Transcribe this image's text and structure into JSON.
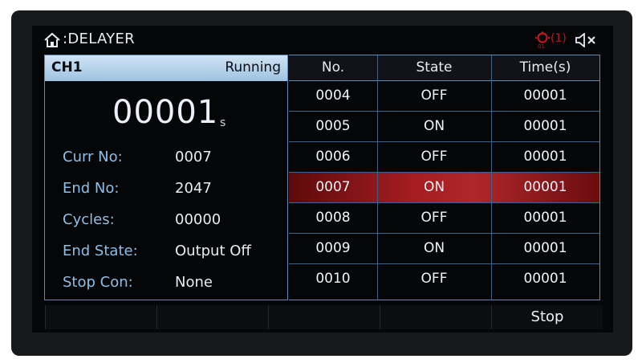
{
  "header": {
    "title": ":DELAYER",
    "icons": [
      "home-icon",
      "overcurrent-warning-icon",
      "speaker-mute-icon"
    ],
    "alert_count": "(1)",
    "alert_color": "#c0181c"
  },
  "channel": {
    "name": "CH1",
    "status": "Running",
    "time_value": "00001",
    "time_unit": "s",
    "fields": [
      {
        "label": "Curr No:",
        "value": "0007"
      },
      {
        "label": "End No:",
        "value": "2047"
      },
      {
        "label": "Cycles:",
        "value": "00000"
      },
      {
        "label": "End State:",
        "value": "Output Off"
      },
      {
        "label": "Stop Con:",
        "value": "None"
      }
    ]
  },
  "table": {
    "headers": [
      "No.",
      "State",
      "Time(s)"
    ],
    "rows": [
      {
        "no": "0004",
        "state": "OFF",
        "time": "00001"
      },
      {
        "no": "0005",
        "state": "ON",
        "time": "00001"
      },
      {
        "no": "0006",
        "state": "OFF",
        "time": "00001"
      },
      {
        "no": "0007",
        "state": "ON",
        "time": "00001"
      },
      {
        "no": "0008",
        "state": "OFF",
        "time": "00001"
      },
      {
        "no": "0009",
        "state": "ON",
        "time": "00001"
      },
      {
        "no": "0010",
        "state": "OFF",
        "time": "00001"
      }
    ],
    "selected_index": 3,
    "highlight_color": "#b0262a"
  },
  "softkeys": [
    "",
    "",
    "",
    "",
    "Stop"
  ],
  "colors": {
    "label_blue": "#8fbfe8",
    "border_blue": "#5f8ab3",
    "header_bar": "#cfe3f4"
  }
}
